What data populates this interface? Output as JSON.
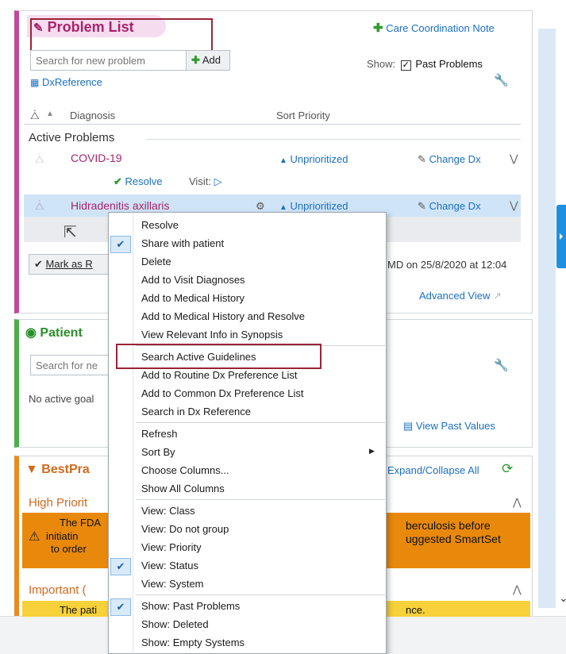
{
  "problem_list": {
    "title": "Problem List",
    "care_coord_note": "Care Coordination Note",
    "search_placeholder": "Search for new problem",
    "add_label": "Add",
    "show_label": "Show:",
    "past_problems_label": "Past Problems",
    "dx_reference": "DxReference",
    "col_diagnosis": "Diagnosis",
    "col_sort_priority": "Sort Priority",
    "section_active": "Active Problems",
    "rows": [
      {
        "diagnosis": "COVID-19",
        "priority": "Unprioritized",
        "change_dx": "Change Dx",
        "resolve": "Resolve",
        "visit": "Visit:"
      },
      {
        "diagnosis": "Hidradenitis axillaris",
        "priority": "Unprioritized",
        "change_dx": "Change Dx"
      }
    ],
    "mark_as": "Mark as R",
    "reviewed_text": "MD on 25/8/2020 at 12:04",
    "advanced_view": "Advanced View"
  },
  "goals": {
    "title": "Patient",
    "search_placeholder": "Search for ne",
    "no_goals": "No active goal",
    "view_past_values": "View Past Values"
  },
  "bpa": {
    "title": "BestPra",
    "expand_collapse": "Expand/Collapse All",
    "high_priority": "High Priorit",
    "high_text_1": "The FDA",
    "high_text_2": "initiatin",
    "high_text_3": "to order",
    "high_text_r1": "berculosis before",
    "high_text_r2": "uggested SmartSet",
    "important": "Important (",
    "important_text": "The pati",
    "important_text_r": "nce."
  },
  "context_menu": {
    "items": [
      "Resolve",
      "Share with patient",
      "Delete",
      "Add to Visit Diagnoses",
      "Add to Medical History",
      "Add to Medical History and Resolve",
      "View Relevant Info in Synopsis",
      "Search Active Guidelines",
      "Add to Routine Dx Preference List",
      "Add to Common Dx Preference List",
      "Search in Dx Reference",
      "Refresh",
      "Sort By",
      "Choose Columns...",
      "Show All Columns",
      "View: Class",
      "View: Do not group",
      "View: Priority",
      "View: Status",
      "View: System",
      "Show: Past Problems",
      "Show: Deleted",
      "Show: Empty Systems"
    ]
  },
  "colors": {
    "problem_list_accent": "#c04a9a",
    "goals_accent": "#4cae4c",
    "bpa_accent": "#ea8a1c",
    "link": "#1a6fc4",
    "highlight_outline": "#9b2335"
  },
  "icons": [
    "plus-icon",
    "checkbox-checked-icon",
    "wrench-icon",
    "dx-reference-icon",
    "pin-icon",
    "sort-arrow-icon",
    "chevron-down-icon",
    "pencil-icon",
    "checkmark-icon",
    "visit-icon",
    "gears-icon",
    "cursor-icon",
    "target-icon",
    "funnel-icon",
    "refresh-icon",
    "warning-icon",
    "submenu-arrow-icon"
  ]
}
